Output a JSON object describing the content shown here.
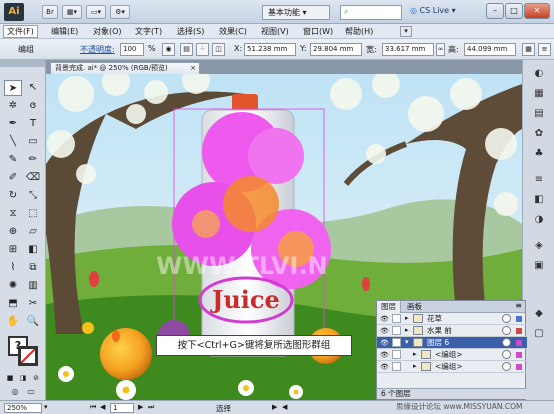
{
  "app": {
    "logo": "Ai",
    "bridge_label": "Br",
    "workspace": "基本功能",
    "cs_live": "CS Live",
    "window_controls": {
      "minimize": "–",
      "maximize": "□",
      "close": "✕"
    }
  },
  "menu": {
    "items": [
      "文件(F)",
      "编辑(E)",
      "对象(O)",
      "文字(T)",
      "选择(S)",
      "效果(C)",
      "视图(V)",
      "窗口(W)",
      "帮助(H)"
    ]
  },
  "control_bar": {
    "selection_label": "编组",
    "opacity_label": "不透明度:",
    "opacity_value": "100",
    "opacity_unit": "%",
    "x_label": "X:",
    "x_value": "51.238 mm",
    "y_label": "Y:",
    "y_value": "29.804 mm",
    "w_label": "宽:",
    "w_value": "33.617 mm",
    "h_label": "高:",
    "h_value": "44.099 mm"
  },
  "document": {
    "tab_title": "背景完成. ai* @ 250% (RGB/预览)",
    "tab_close": "×",
    "can_label": "Juice",
    "watermark_text": "WWW.TLVI.N",
    "hint": "按下<Ctrl+G>键将复所选图形群组"
  },
  "layers_panel": {
    "tabs": [
      "图层",
      "画板"
    ],
    "rows": [
      {
        "name": "花草",
        "indent": 0,
        "swatch": "#4a72d0"
      },
      {
        "name": "水果 前",
        "indent": 0,
        "swatch": "#d04a4a"
      },
      {
        "name": "图层 6",
        "indent": 0,
        "swatch": "#d04ad0"
      },
      {
        "name": "<编组>",
        "indent": 1,
        "swatch": "#d04ad0"
      },
      {
        "name": "<编组>",
        "indent": 1,
        "swatch": "#d04ad0"
      }
    ],
    "footer": "6 个图层"
  },
  "status_bar": {
    "zoom": "250%",
    "page": "1",
    "tool": "选择"
  },
  "site_watermark": "思缘设计论坛 www.MISSYUAN.COM",
  "colors": {
    "selection_magenta": "#e83ee8",
    "menu_bg": "#e3e9f2",
    "panel_selected": "#3b5fa8"
  }
}
